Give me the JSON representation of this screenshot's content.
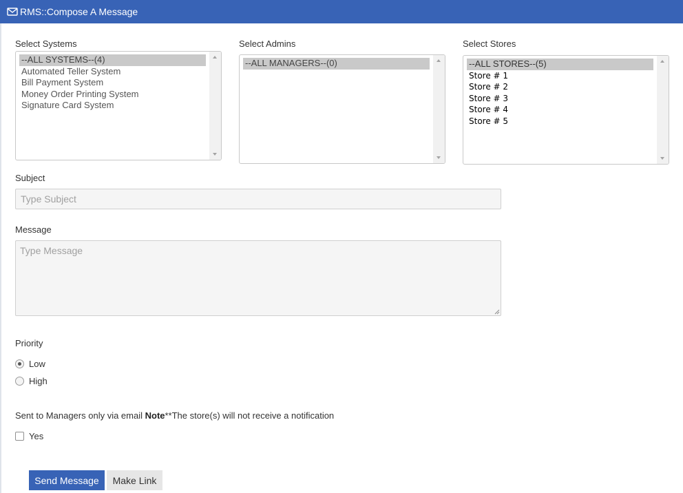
{
  "window": {
    "title": "RMS::Compose A Message",
    "title_icon": "envelope-icon"
  },
  "systems": {
    "label": "Select Systems",
    "options": [
      "--ALL SYSTEMS--(4)",
      "Automated Teller System",
      "Bill Payment System",
      "Money Order Printing System",
      "Signature Card System"
    ],
    "selected_index": 0
  },
  "admins": {
    "label": "Select Admins",
    "options": [
      "--ALL MANAGERS--(0)"
    ],
    "selected_index": 0
  },
  "stores": {
    "label": "Select Stores",
    "options": [
      "--ALL STORES--(5)",
      "Store # 1",
      "Store # 2",
      "Store # 3",
      "Store # 4",
      "Store # 5"
    ],
    "selected_index": 0
  },
  "subject": {
    "label": "Subject",
    "placeholder": "Type Subject",
    "value": ""
  },
  "message": {
    "label": "Message",
    "placeholder": "Type Message",
    "value": ""
  },
  "priority": {
    "label": "Priority",
    "options": [
      {
        "label": "Low",
        "checked": true
      },
      {
        "label": "High",
        "checked": false
      }
    ]
  },
  "email_only": {
    "text_before": "Sent to Managers only via email ",
    "note_bold": "Note",
    "text_after": "**The store(s) will not receive a notification",
    "checkbox_label": "Yes",
    "checked": false
  },
  "actions": {
    "send_label": "Send Message",
    "link_label": "Make Link"
  },
  "colors": {
    "accent": "#3863b6",
    "selected_option": "#c9c9c9"
  }
}
